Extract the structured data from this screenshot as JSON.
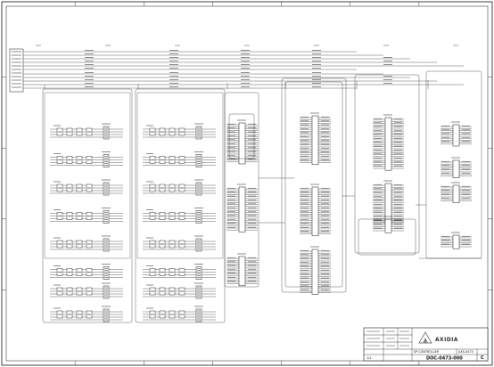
{
  "sheet": {
    "zones_top": [
      "1",
      "2",
      "3",
      "4",
      "5",
      "6",
      "7"
    ],
    "zones_side": [
      "A",
      "B",
      "C",
      "D",
      "E"
    ]
  },
  "title_block": {
    "logo_text": "AXIDIA",
    "title": "SP CONTROLLER",
    "doc_number": "DOC-0473-000",
    "part_number": "AXS-0473",
    "revision": "C",
    "sheet": "1/1"
  },
  "colors": {
    "line": "#1a1a1a",
    "background": "#ffffff"
  }
}
